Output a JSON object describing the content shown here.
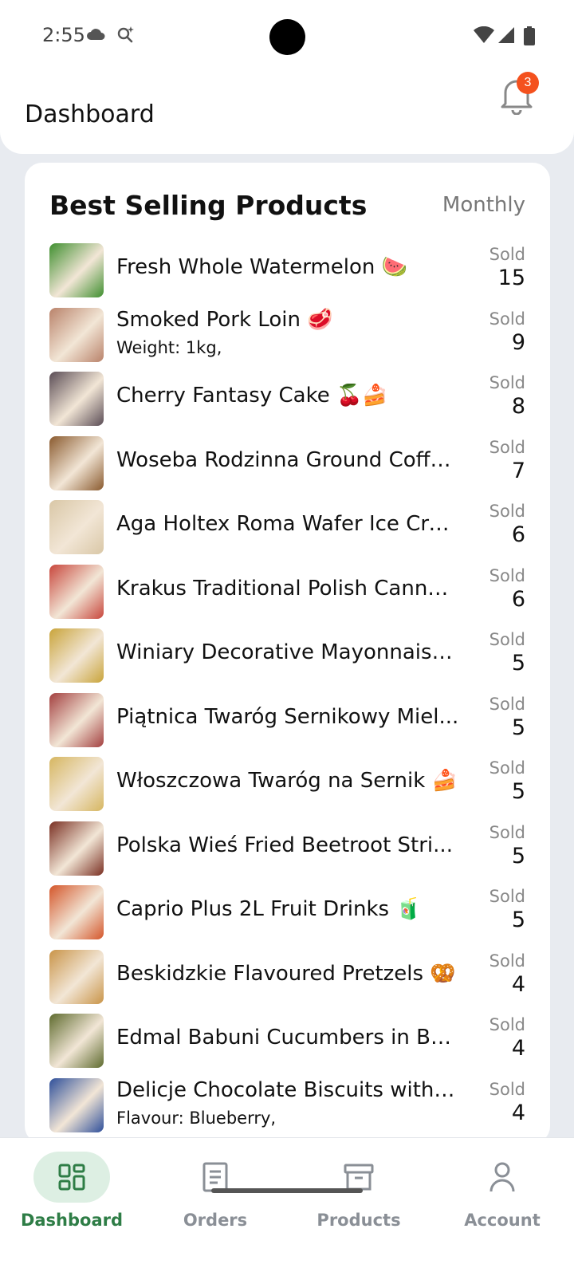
{
  "status_bar": {
    "time": "2:55"
  },
  "header": {
    "title": "Dashboard",
    "notification_count": "3"
  },
  "best_selling": {
    "title": "Best Selling Products",
    "period": "Monthly",
    "sold_label": "Sold",
    "items": [
      {
        "name": "Fresh Whole Watermelon 🍉",
        "variant": "",
        "sold": "15",
        "thumb_color": "#3f8f2f"
      },
      {
        "name": "Smoked Pork Loin 🥩",
        "variant": "Weight: 1kg,",
        "sold": "9",
        "thumb_color": "#b9826a"
      },
      {
        "name": "Cherry Fantasy Cake 🍒🍰",
        "variant": "",
        "sold": "8",
        "thumb_color": "#5a4c55"
      },
      {
        "name": "Woseba Rodzinna Ground Coffe...",
        "variant": "",
        "sold": "7",
        "thumb_color": "#8a5a2e"
      },
      {
        "name": "Aga Holtex Roma Wafer Ice Cre...",
        "variant": "",
        "sold": "6",
        "thumb_color": "#d9c7a6"
      },
      {
        "name": "Krakus Traditional Polish Canne...",
        "variant": "",
        "sold": "6",
        "thumb_color": "#c8463c"
      },
      {
        "name": "Winiary Decorative Mayonnaise ...",
        "variant": "",
        "sold": "5",
        "thumb_color": "#c9a43a"
      },
      {
        "name": "Piątnica Twaróg Sernikowy Miel...",
        "variant": "",
        "sold": "5",
        "thumb_color": "#a33f3f"
      },
      {
        "name": "Włoszczowa Twaróg na Sernik 🍰",
        "variant": "",
        "sold": "5",
        "thumb_color": "#d6b660"
      },
      {
        "name": "Polska Wieś Fried Beetroot Stri...",
        "variant": "",
        "sold": "5",
        "thumb_color": "#7a2f22"
      },
      {
        "name": "Caprio Plus 2L Fruit Drinks 🧃",
        "variant": "",
        "sold": "5",
        "thumb_color": "#d4562a"
      },
      {
        "name": "Beskidzkie Flavoured Pretzels 🥨",
        "variant": "",
        "sold": "4",
        "thumb_color": "#c99448"
      },
      {
        "name": "Edmal Babuni Cucumbers in Bri...",
        "variant": "",
        "sold": "4",
        "thumb_color": "#5e6b2e"
      },
      {
        "name": "Delicje Chocolate Biscuits with ...",
        "variant": "Flavour: Blueberry,",
        "sold": "4",
        "thumb_color": "#2e4f9a"
      }
    ]
  },
  "bottom_nav": {
    "items": [
      {
        "label": "Dashboard",
        "icon": "dashboard-icon",
        "active": true
      },
      {
        "label": "Orders",
        "icon": "orders-icon",
        "active": false
      },
      {
        "label": "Products",
        "icon": "products-icon",
        "active": false
      },
      {
        "label": "Account",
        "icon": "account-icon",
        "active": false
      }
    ]
  },
  "colors": {
    "accent": "#2e7d46",
    "badge": "#f4511e",
    "background": "#e8ebf0"
  }
}
